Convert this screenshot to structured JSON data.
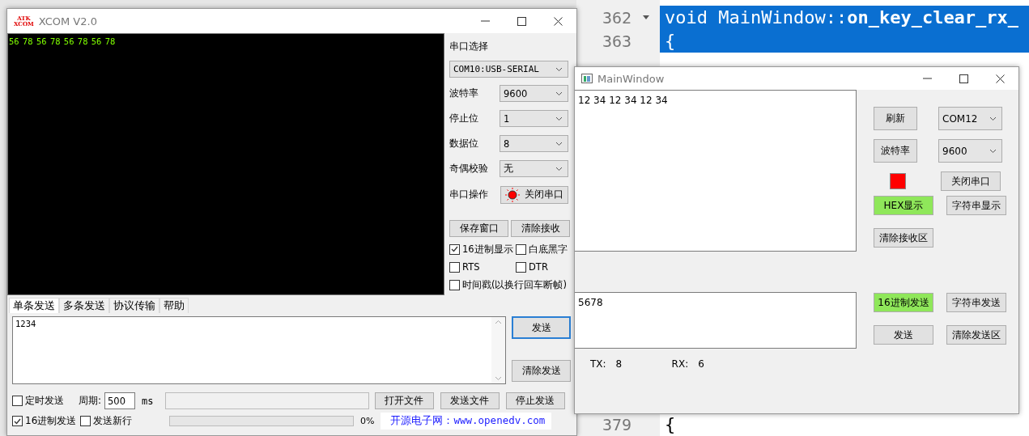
{
  "editor": {
    "lines": [
      {
        "number": "362",
        "code": "void MainWindow::**on_key_clear_rx_**",
        "selected": true,
        "fold_marker": true
      },
      {
        "number": "363",
        "code": "{",
        "selected": true,
        "fold_marker": false
      },
      {
        "number": "379",
        "code": "{",
        "selected": false,
        "fold_marker": false
      }
    ]
  },
  "xcom": {
    "title": "XCOM V2.0",
    "logo_top": "ATK",
    "logo_bottom": "XCOM",
    "receive_text": "56 78 56 78 56 78 56 78",
    "port_label": "串口选择",
    "port": "COM10:USB-SERIAL",
    "settings": [
      {
        "label": "波特率",
        "value": "9600"
      },
      {
        "label": "停止位",
        "value": "1"
      },
      {
        "label": "数据位",
        "value": "8"
      },
      {
        "label": "奇偶校验",
        "value": "无"
      }
    ],
    "operation_label": "串口操作",
    "operation_button": {
      "label": "关闭串口",
      "port_open": true
    },
    "receive_buttons": [
      "保存窗口",
      "清除接收"
    ],
    "receive_options": [
      {
        "label": "16进制显示",
        "checked": true
      },
      {
        "label": "白底黑字",
        "checked": false
      },
      {
        "label": "RTS",
        "checked": false
      },
      {
        "label": "DTR",
        "checked": false
      },
      {
        "label": "时间戳(以换行回车断帧)",
        "checked": false
      }
    ],
    "tabs": [
      {
        "label": "单条发送",
        "selected": true
      },
      {
        "label": "多条发送",
        "selected": false
      },
      {
        "label": "协议传输",
        "selected": false
      },
      {
        "label": "帮助",
        "selected": false
      }
    ],
    "send_text": "1234",
    "send_button": "发送",
    "clear_send_button": "清除发送",
    "timed_send": {
      "label": "定时发送",
      "checked": false
    },
    "period_label": "周期:",
    "period": "500",
    "period_unit": "ms",
    "file_buttons": [
      "打开文件",
      "发送文件",
      "停止发送"
    ],
    "hex_send": {
      "label": "16进制发送",
      "checked": true
    },
    "send_newline": {
      "label": "发送新行",
      "checked": false
    },
    "progress": {
      "level": 0,
      "reading": "0%"
    },
    "link": "开源电子网：www.openedv.com"
  },
  "main_window": {
    "title": "MainWindow",
    "receive_text": "12 34 12 34 12 34",
    "refresh_button": "刷新",
    "port": "COM12",
    "baud_button": "波特率",
    "baud": "9600",
    "indicator": {
      "on": true
    },
    "close_button": "关闭串口",
    "display_modes": [
      {
        "label": "HEX显示",
        "selected": true
      },
      {
        "label": "字符串显示",
        "selected": false
      }
    ],
    "clear_receive_button": "清除接收区",
    "send_text": "5678",
    "send_modes": [
      {
        "label": "16进制发送",
        "selected": true
      },
      {
        "label": "字符串发送",
        "selected": false
      }
    ],
    "send_button": "发送",
    "clear_send_button": "清除发送区",
    "tx_label": "TX:",
    "tx": "8",
    "rx_label": "RX:",
    "rx": "6"
  }
}
